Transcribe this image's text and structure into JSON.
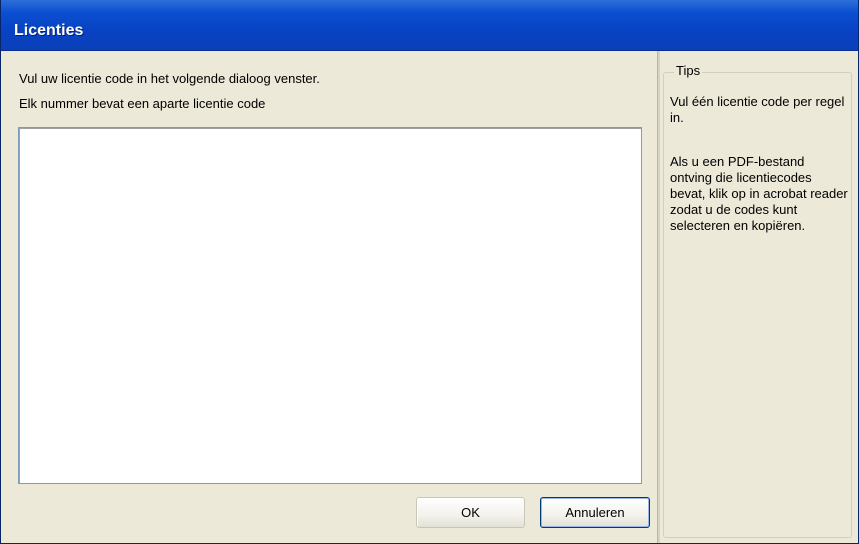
{
  "window": {
    "title": "Licenties"
  },
  "instructions": {
    "line1": "Vul uw licentie code in het volgende dialoog venster.",
    "line2": "Elk nummer bevat een aparte licentie code"
  },
  "license_input": {
    "value": "",
    "placeholder": ""
  },
  "buttons": {
    "ok_label": "OK",
    "cancel_label": "Annuleren"
  },
  "tips": {
    "legend": "Tips",
    "tip1": "Vul één licentie code per regel in.",
    "tip2": "Als u een PDF-bestand ontving die licentiecodes bevat, klik op in acrobat reader zodat u de codes kunt selecteren en kopiëren."
  },
  "colors": {
    "titlebar": "#0843c4",
    "dialog_background": "#ece9d8",
    "input_border": "#7f9db9",
    "button_focus_border": "#003c74"
  }
}
